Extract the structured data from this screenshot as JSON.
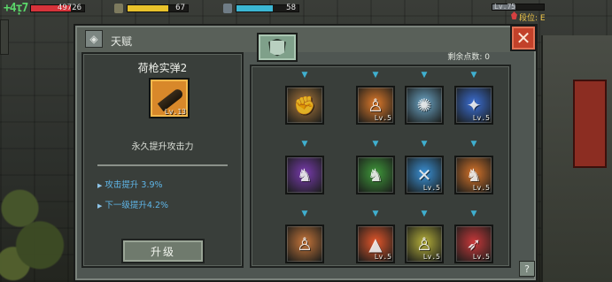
{
  "hud": {
    "hp_icon_text": "+4ᴉ7",
    "hp_value": "49726",
    "hp_fraction": 0.75,
    "stamina_value": "67",
    "stamina_fraction": 0.67,
    "water_value": "58",
    "water_fraction": 0.58,
    "level_label": "Lv.75",
    "level_fraction": 0.45,
    "rank_label": "段位: E"
  },
  "window": {
    "title": "天赋",
    "close_label": "✕",
    "points_label": "剩余点数: 0",
    "help_label": "?"
  },
  "left_panel": {
    "skill_name": "荷枪实弹2",
    "skill_level": "Lv.13",
    "description": "永久提升攻击力",
    "stat_current": "攻击提升 3.9%",
    "stat_next": "下一级提升4.2%",
    "upgrade_label": "升级"
  },
  "talent_nodes": [
    {
      "name": "power-fist",
      "glyph": "✊",
      "color": "#b07a3c",
      "level": ""
    },
    {
      "name": "fire-body",
      "glyph": "♙",
      "color": "#e07a2a",
      "level": "Lv.5"
    },
    {
      "name": "frost-burst",
      "glyph": "✺",
      "color": "#6ca6c8",
      "level": ""
    },
    {
      "name": "ice-crystal",
      "glyph": "✦",
      "color": "#3b6fd6",
      "level": "Lv.5"
    },
    {
      "name": "shadow-kick",
      "glyph": "♞",
      "color": "#7a3bb0",
      "level": ""
    },
    {
      "name": "poison-kick",
      "glyph": "♞",
      "color": "#3f9a3a",
      "level": ""
    },
    {
      "name": "dual-guns-ice",
      "glyph": "✕",
      "color": "#3a92d8",
      "level": "Lv.5"
    },
    {
      "name": "fire-kick",
      "glyph": "♞",
      "color": "#d8742a",
      "level": "Lv.5"
    },
    {
      "name": "rage-body",
      "glyph": "♙",
      "color": "#c8763a",
      "level": ""
    },
    {
      "name": "flame-pillar",
      "glyph": "▲",
      "color": "#e5562a",
      "level": "Lv.5"
    },
    {
      "name": "toxic-body",
      "glyph": "♙",
      "color": "#b6b03a",
      "level": "Lv.5"
    },
    {
      "name": "green-sprint",
      "glyph": "➶",
      "color": "#c9383a",
      "level": "Lv.5"
    }
  ]
}
